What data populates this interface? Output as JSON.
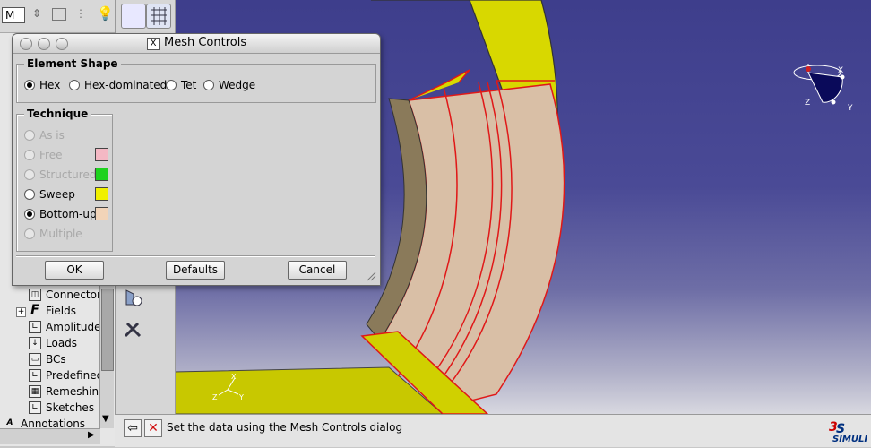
{
  "dialog": {
    "title": "Mesh Controls",
    "element_shape": {
      "title": "Element Shape",
      "options": [
        {
          "label": "Hex",
          "selected": true
        },
        {
          "label": "Hex-dominated",
          "selected": false
        },
        {
          "label": "Tet",
          "selected": false
        },
        {
          "label": "Wedge",
          "selected": false
        }
      ]
    },
    "technique": {
      "title": "Technique",
      "options": [
        {
          "label": "As is",
          "enabled": false,
          "selected": false
        },
        {
          "label": "Free",
          "enabled": false,
          "selected": false,
          "color": "#f4b8c4"
        },
        {
          "label": "Structured",
          "enabled": false,
          "selected": false,
          "color": "#1ed21e"
        },
        {
          "label": "Sweep",
          "enabled": true,
          "selected": false,
          "color": "#f0f000"
        },
        {
          "label": "Bottom-up",
          "enabled": true,
          "selected": true,
          "color": "#f2d4b8"
        },
        {
          "label": "Multiple",
          "enabled": false,
          "selected": false
        }
      ]
    },
    "buttons": {
      "ok": "OK",
      "defaults": "Defaults",
      "cancel": "Cancel"
    }
  },
  "tree": {
    "combo_value": "M",
    "items": [
      {
        "label": "Connector"
      },
      {
        "label": "Fields"
      },
      {
        "label": "Amplitudes"
      },
      {
        "label": "Loads"
      },
      {
        "label": "BCs"
      },
      {
        "label": "Predefined"
      },
      {
        "label": "Remeshing"
      },
      {
        "label": "Sketches"
      },
      {
        "label": "Annotations"
      }
    ]
  },
  "prompt": {
    "text": "Set the data using the Mesh Controls dialog"
  },
  "brand": {
    "logo_text": "SIMULI"
  },
  "triad": {
    "x": "X",
    "y": "Y",
    "z": "Z"
  },
  "colors": {
    "mesh_yellow": "#d8d800",
    "mesh_tan": "#d9bfa6",
    "edge_red": "#e01818",
    "viewport_top": "#3e3e8c"
  }
}
